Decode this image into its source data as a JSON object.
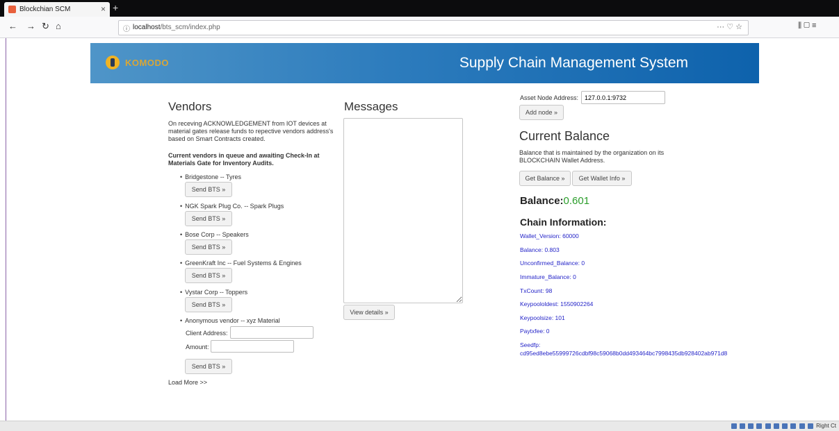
{
  "browser": {
    "tab_title": "Blockchian SCM",
    "tab_close": "×",
    "new_tab": "+",
    "url_host": "localhost",
    "url_path": "/bts_scm/index.php",
    "url_info_icon": "ⓘ",
    "url_actions": "··· ♡ ☆",
    "nav_back": "←",
    "nav_forward": "→",
    "nav_reload": "↻",
    "nav_home": "⌂",
    "menu_icons": "⫼ ▢ ≡"
  },
  "banner": {
    "logo_text": "KOMODO",
    "title": "Supply Chain Management System"
  },
  "vendors": {
    "heading": "Vendors",
    "desc": "On receving ACKNOWLEDGEMENT from IOT devices at material gates release funds to repective vendors address's based on Smart Contracts created.",
    "subheading": "Current vendors in queue and awaiting Check-In at Materials Gate for Inventory Audits.",
    "items": [
      {
        "label": "Bridgestone -- Tyres",
        "button": "Send BTS »"
      },
      {
        "label": "NGK Spark Plug Co. -- Spark Plugs",
        "button": "Send BTS »"
      },
      {
        "label": "Bose Corp -- Speakers",
        "button": "Send BTS »"
      },
      {
        "label": "GreenKraft Inc -- Fuel Systems & Engines",
        "button": "Send BTS »"
      },
      {
        "label": "Vystar Corp -- Toppers",
        "button": "Send BTS »"
      }
    ],
    "anon": {
      "label": "Anonymous vendor -- xyz Material",
      "client_label": "Client Address:",
      "client_value": "",
      "amount_label": "Amount:",
      "amount_value": "",
      "button": "Send BTS »"
    },
    "load_more": "Load More >>"
  },
  "messages": {
    "heading": "Messages",
    "text": "",
    "button": "View details »"
  },
  "right": {
    "node_label": "Asset Node Address:",
    "node_value": "127.0.0.1:9732",
    "add_node": "Add node »",
    "balance_heading": "Current Balance",
    "balance_desc": "Balance that is maintained by the organization on its BLOCKCHAIN Wallet Address.",
    "get_balance": "Get Balance »",
    "get_wallet": "Get Wallet Info »",
    "balance_label": "Balance:",
    "balance_value": "0.601",
    "chain_heading": "Chain Information:",
    "chain_items": [
      "Wallet_Version: 60000",
      "Balance: 0.803",
      "Unconfirmed_Balance: 0",
      "Immature_Balance: 0",
      "TxCount: 98",
      "Keypoololdest: 1550902264",
      "Keypoolsize: 101",
      "Paytxfee: 0"
    ],
    "seedfp_label": "Seedfp:",
    "seedfp_value": "cd95ed8ebe55999726cdbf98c59068b0dd493464bc7998435db928402ab971d8"
  },
  "statusbar": {
    "text": "Right Ct"
  },
  "colors": {
    "balance_green": "#2a9d2a",
    "link_blue": "#2424c8"
  }
}
